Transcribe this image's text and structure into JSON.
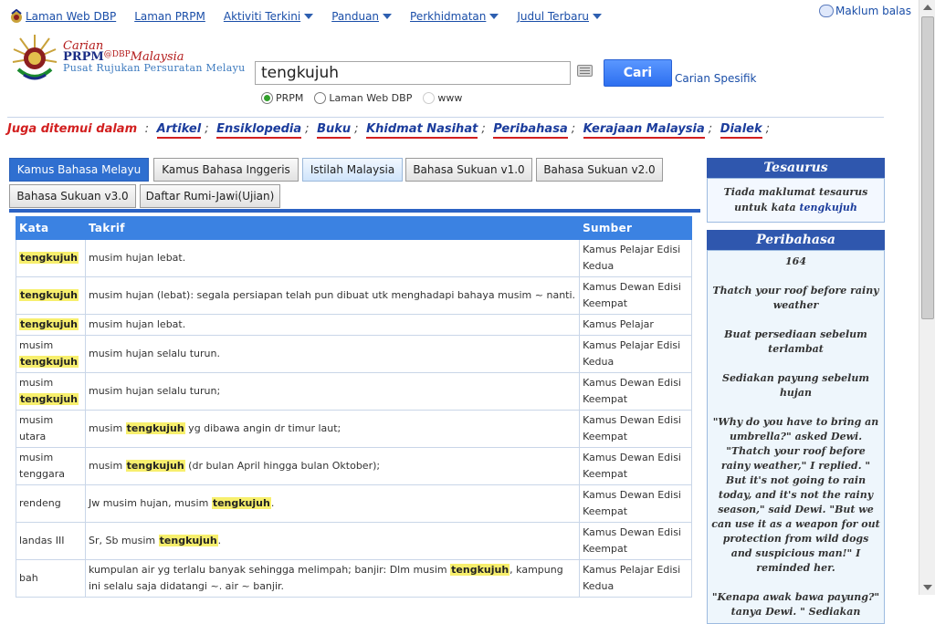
{
  "topnav": {
    "links": [
      "Laman Web DBP",
      "Laman PRPM"
    ],
    "dropdowns": [
      "Aktiviti Terkini",
      "Panduan",
      "Perkhidmatan",
      "Judul Terbaru"
    ],
    "feedback": "Maklum balas"
  },
  "brand": {
    "line1": "Carian",
    "line2": "PRPM",
    "line2_sup": "@DBP",
    "line2_country": "Malaysia",
    "line3": "Pusat Rujukan Persuratan Melayu"
  },
  "search": {
    "value": "tengkujuh",
    "button": "Cari",
    "specific": "Carian Spesifik",
    "options": [
      "PRPM",
      "Laman Web DBP",
      "www"
    ],
    "selected": "PRPM"
  },
  "juga": {
    "label": "Juga ditemui dalam",
    "links": [
      "Artikel",
      "Ensiklopedia",
      "Buku",
      "Khidmat Nasihat",
      "Peribahasa",
      "Kerajaan Malaysia",
      "Dialek"
    ]
  },
  "tabs": {
    "row1": [
      "Kamus Bahasa Melayu",
      "Kamus Bahasa Inggeris",
      "Istilah Malaysia",
      "Bahasa Sukuan v1.0",
      "Bahasa Sukuan v2.0"
    ],
    "row2": [
      "Bahasa Sukuan v3.0",
      "Daftar Rumi-Jawi(Ujian)"
    ],
    "active": "Kamus Bahasa Melayu"
  },
  "table": {
    "headers": [
      "Kata",
      "Takrif",
      "Sumber"
    ],
    "rows": [
      {
        "kata_pre": "",
        "kata_hl": "tengkujuh",
        "takrif_pre": "musim hujan lebat.",
        "takrif_hl": "",
        "takrif_post": "",
        "sumber": "Kamus Pelajar Edisi Kedua"
      },
      {
        "kata_pre": "",
        "kata_hl": "tengkujuh",
        "takrif_pre": "musim hujan (lebat): segala persiapan telah pun dibuat utk menghadapi bahaya musim ~ nanti.",
        "takrif_hl": "",
        "takrif_post": "",
        "sumber": "Kamus Dewan Edisi Keempat"
      },
      {
        "kata_pre": "",
        "kata_hl": "tengkujuh",
        "takrif_pre": "musim hujan lebat.",
        "takrif_hl": "",
        "takrif_post": "",
        "sumber": "Kamus Pelajar"
      },
      {
        "kata_pre": "musim",
        "kata_hl": "tengkujuh",
        "takrif_pre": "musim hujan selalu turun.",
        "takrif_hl": "",
        "takrif_post": "",
        "sumber": "Kamus Pelajar Edisi Kedua"
      },
      {
        "kata_pre": "musim",
        "kata_hl": "tengkujuh",
        "takrif_pre": "musim hujan selalu turun;",
        "takrif_hl": "",
        "takrif_post": "",
        "sumber": "Kamus Dewan Edisi Keempat"
      },
      {
        "kata_pre": "musim utara",
        "kata_hl": "",
        "takrif_pre": "musim ",
        "takrif_hl": "tengkujuh",
        "takrif_post": " yg dibawa angin dr timur laut;",
        "sumber": "Kamus Dewan Edisi Keempat"
      },
      {
        "kata_pre": "musim tenggara",
        "kata_hl": "",
        "takrif_pre": "musim ",
        "takrif_hl": "tengkujuh",
        "takrif_post": " (dr bulan April hingga bulan Oktober);",
        "sumber": "Kamus Dewan Edisi Keempat"
      },
      {
        "kata_pre": "rendeng",
        "kata_hl": "",
        "takrif_pre": "Jw musim hujan, musim ",
        "takrif_hl": "tengkujuh",
        "takrif_post": ".",
        "sumber": "Kamus Dewan Edisi Keempat"
      },
      {
        "kata_pre": "landas III",
        "kata_hl": "",
        "takrif_pre": "Sr, Sb musim ",
        "takrif_hl": "tengkujuh",
        "takrif_post": ".",
        "sumber": "Kamus Dewan Edisi Keempat"
      },
      {
        "kata_pre": "bah",
        "kata_hl": "",
        "takrif_pre": "kumpulan air yg terlalu banyak sehingga melimpah; banjir: Dlm musim ",
        "takrif_hl": "tengkujuh",
        "takrif_post": ", kampung ini selalu saja didatangi ~. air ~ banjir.",
        "sumber": "Kamus Pelajar Edisi Kedua"
      }
    ]
  },
  "tesaurus": {
    "title": "Tesaurus",
    "text": "Tiada maklumat tesaurus untuk kata",
    "word": "tengkujuh"
  },
  "peribahasa": {
    "title": "Peribahasa",
    "paragraphs": [
      "164",
      "Thatch your roof before rainy weather",
      "Buat persediaan sebelum terlambat",
      "Sediakan payung sebelum hujan",
      "\"Why do you have to bring an umbrella?\" asked Dewi. \"Thatch your roof before rainy weather,\" I replied. \" But it's not going to rain today, and it's not the rainy season,\" said Dewi. \"But we can use it as a weapon for out protection from wild dogs and suspicious man!\" I reminded her.",
      "\"Kenapa awak bawa payung?\" tanya Dewi. \" Sediakan payung"
    ]
  }
}
